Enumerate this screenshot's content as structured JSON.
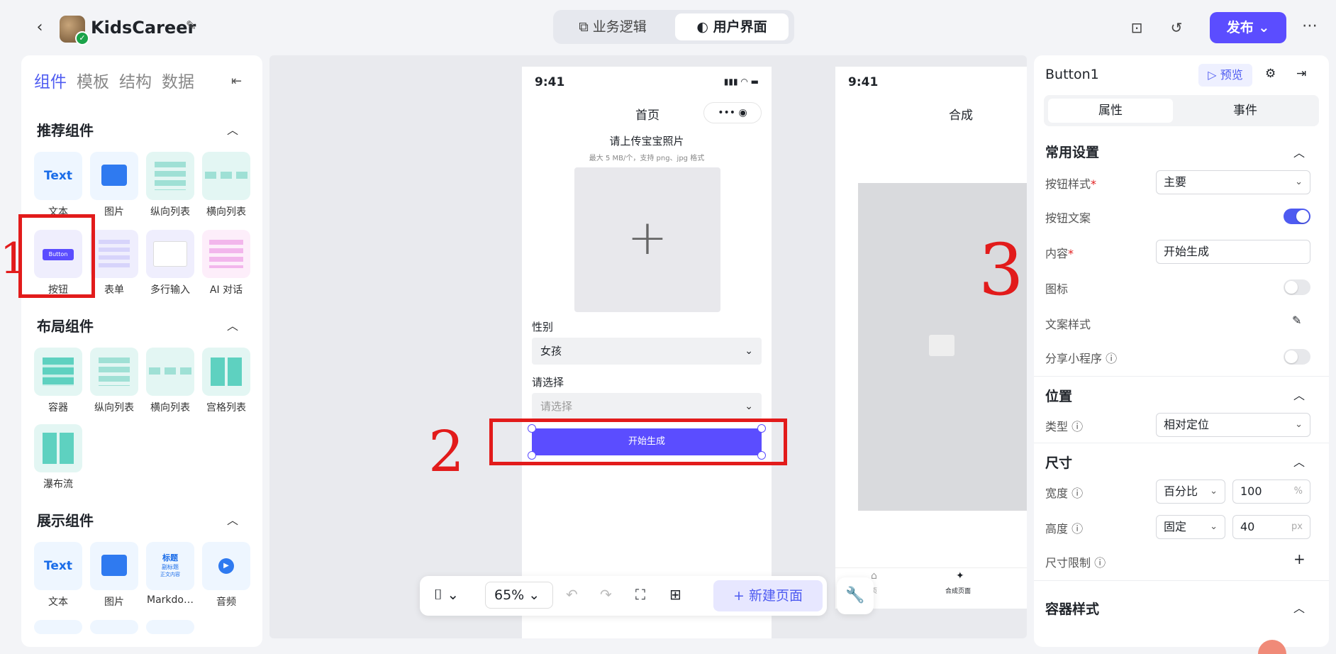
{
  "app": {
    "name": "KidsCareer"
  },
  "top_tabs": [
    {
      "label": "业务逻辑"
    },
    {
      "label": "用户界面"
    }
  ],
  "publish_label": "发布",
  "left_panel": {
    "tabs": [
      "组件",
      "模板",
      "结构",
      "数据"
    ],
    "sections": [
      {
        "title": "推荐组件",
        "items": [
          "文本",
          "图片",
          "纵向列表",
          "横向列表",
          "按钮",
          "表单",
          "多行输入",
          "AI 对话"
        ]
      },
      {
        "title": "布局组件",
        "items": [
          "容器",
          "纵向列表",
          "横向列表",
          "宫格列表",
          "瀑布流"
        ]
      },
      {
        "title": "展示组件",
        "items": [
          "文本",
          "图片",
          "Markdo…",
          "音频"
        ]
      }
    ],
    "thumb_text": "Text",
    "button_thumb": "Button",
    "md_thumb": [
      "标题",
      "副标题",
      "正文内容"
    ]
  },
  "phone1": {
    "time": "9:41",
    "title": "首页",
    "capsule": "•••",
    "upload_title": "请上传宝宝照片",
    "upload_hint": "最大 5 MB/个，支持 png、jpg 格式",
    "gender_label": "性别",
    "gender_value": "女孩",
    "select_label": "请选择",
    "select_placeholder": "请选择",
    "button_text": "开始生成"
  },
  "phone2": {
    "time": "9:41",
    "title": "合成",
    "tab_home": "页",
    "tab_compose": "合成页面"
  },
  "toolbar": {
    "zoom": "65%",
    "new_page": "新建页面"
  },
  "right_panel": {
    "component_name": "Button1",
    "preview": "预览",
    "tabs": [
      "属性",
      "事件"
    ],
    "common_settings": "常用设置",
    "btn_style_label": "按钮样式",
    "btn_style_value": "主要",
    "btn_text_label": "按钮文案",
    "content_label": "内容",
    "content_value": "开始生成",
    "icon_label": "图标",
    "text_style_label": "文案样式",
    "share_label": "分享小程序",
    "position_title": "位置",
    "type_label": "类型",
    "type_value": "相对定位",
    "size_title": "尺寸",
    "width_label": "宽度",
    "width_mode": "百分比",
    "width_value": "100",
    "width_unit": "%",
    "height_label": "高度",
    "height_mode": "固定",
    "height_value": "40",
    "height_unit": "px",
    "size_limit_label": "尺寸限制",
    "container_style_title": "容器样式"
  },
  "annotations": [
    "1",
    "2",
    "3"
  ],
  "colors": {
    "accent": "#5b4dff",
    "annotation": "#e21b1b"
  }
}
